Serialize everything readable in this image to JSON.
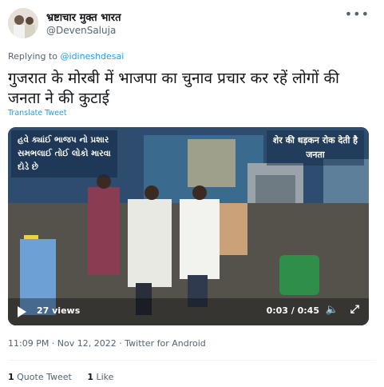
{
  "author": {
    "name": "भ्रष्टाचार मुक्त भारत",
    "handle": "@DevenSaluja",
    "more_icon": "more-icon"
  },
  "reply": {
    "prefix": "Replying to ",
    "to": "@idineshdesai"
  },
  "tweet": {
    "text": "गुजरात के मोरबी में भाजपा का चुनाव प्रचार कर रहें लोगों की जनता ने की कुटाई",
    "translate_label": "Translate Tweet"
  },
  "video": {
    "caption_left_line1": "હવે ક્યાંઈ ભાજપ નો પ્રશાર",
    "caption_left_line2": "સમભલાઈ તોઈ લોકો મારવા",
    "caption_left_line3": "દોડે છે",
    "caption_right_line1": "शेर की धड़कन रोक देती है",
    "caption_right_line2": "जनता",
    "views": "27 views",
    "time": "0:03 / 0:45",
    "icons": [
      "play-icon",
      "volume-icon",
      "fullscreen-icon"
    ]
  },
  "meta": {
    "timestamp": "11:09 PM · Nov 12, 2022 · Twitter for Android"
  },
  "stats": {
    "quotes_count": "1",
    "quotes_label": " Quote Tweet",
    "likes_count": "1",
    "likes_label": " Like"
  },
  "colors": {
    "link": "#1d9bf0",
    "secondary_text": "#536471",
    "primary_text": "#0f1419"
  }
}
